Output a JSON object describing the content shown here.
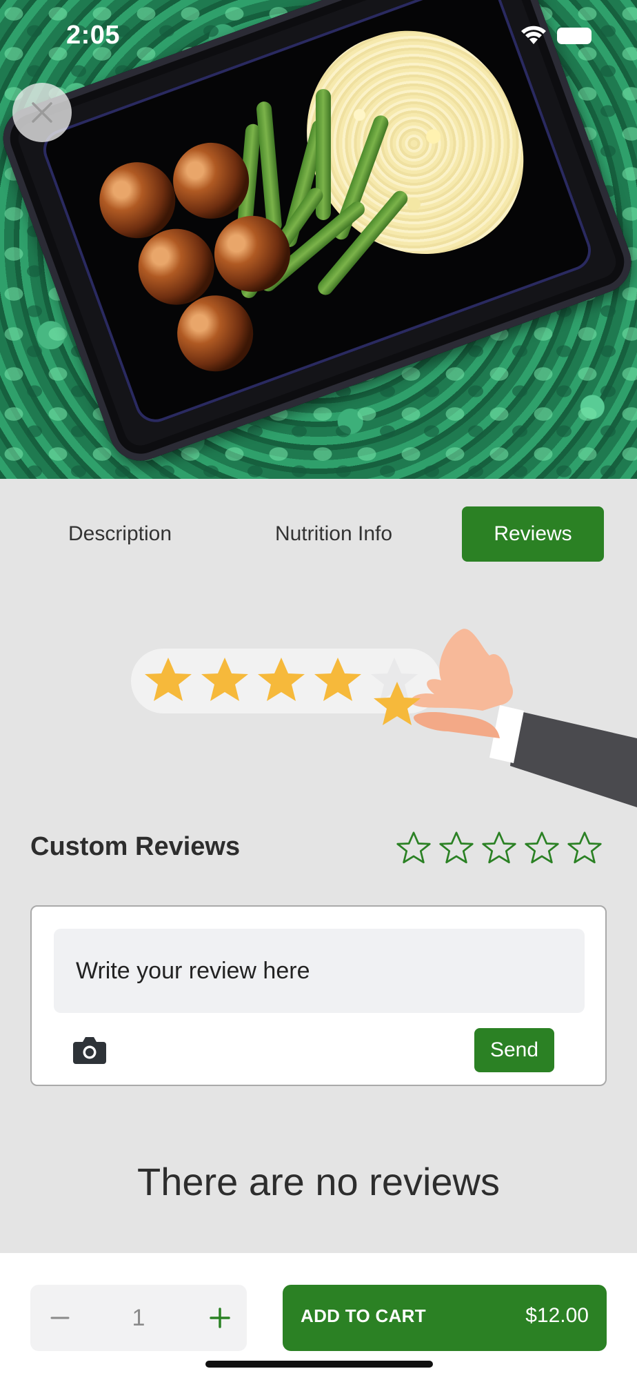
{
  "status_bar": {
    "time": "2:05",
    "icons": [
      "wifi-icon",
      "battery-icon"
    ]
  },
  "hero": {
    "image_alt": "meal-image",
    "close_icon": "close-icon"
  },
  "tabs": [
    {
      "label": "Description",
      "active": false
    },
    {
      "label": "Nutrition Info",
      "active": false
    },
    {
      "label": "Reviews",
      "active": true
    }
  ],
  "custom_reviews": {
    "title": "Custom Reviews",
    "rating": 0,
    "max_rating": 5,
    "placeholder": "Write your review here",
    "send_label": "Send"
  },
  "empty_state": {
    "message": "There are no reviews"
  },
  "cart": {
    "quantity": "1",
    "add_label": "ADD TO CART",
    "price": "$12.00"
  },
  "colors": {
    "accent": "#2b8124",
    "background": "#e4e4e4",
    "star_fill": "#f6b93b"
  }
}
